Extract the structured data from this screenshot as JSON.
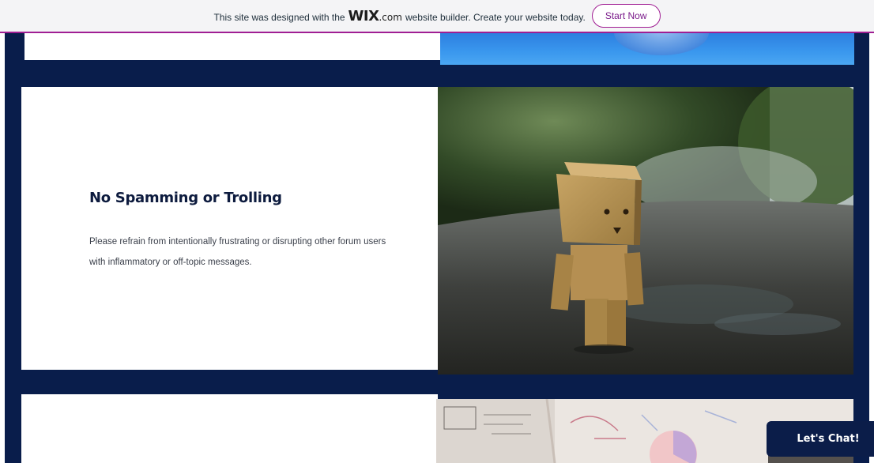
{
  "banner": {
    "text_before": "This site was designed with the",
    "logo_text": "WIX",
    "logo_suffix": ".com",
    "text_after": "website builder. Create your website today.",
    "cta_label": "Start Now"
  },
  "section_main": {
    "title": "No Spamming or Trolling",
    "body": "Please refrain from intentionally frustrating or disrupting other forum users with inflammatory or off-topic messages."
  },
  "chat": {
    "label": "Let's Chat!"
  },
  "colors": {
    "navy_background": "#091d4b",
    "wix_accent": "#a01e93",
    "title_text": "#0d1b3e"
  }
}
